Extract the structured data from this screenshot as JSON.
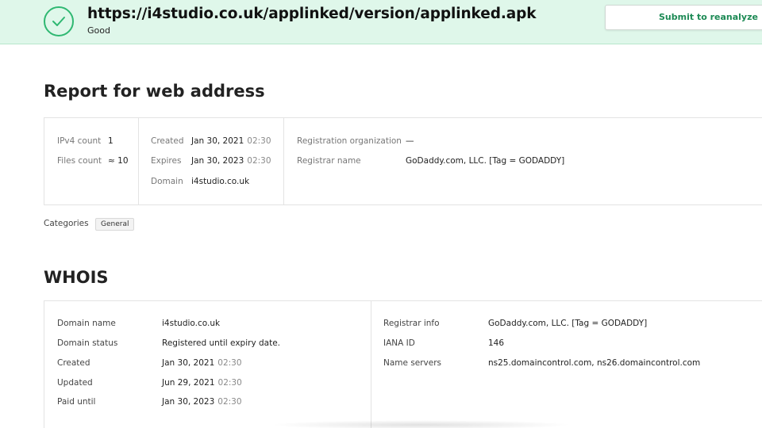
{
  "header": {
    "url": "https://i4studio.co.uk/applinked/version/applinked.apk",
    "verdict": "Good",
    "submit_label": "Submit to reanalyze",
    "status_icon": "check-circle-icon"
  },
  "report": {
    "title": "Report for web address",
    "col1": [
      {
        "label": "IPv4 count",
        "value": "1"
      },
      {
        "label": "Files count",
        "value": "≈ 10"
      }
    ],
    "col2": [
      {
        "label": "Created",
        "value": "Jan 30, 2021",
        "time": "02:30"
      },
      {
        "label": "Expires",
        "value": "Jan 30, 2023",
        "time": "02:30"
      },
      {
        "label": "Domain",
        "value": "i4studio.co.uk"
      }
    ],
    "col3": [
      {
        "label": "Registration organization",
        "value": "—"
      },
      {
        "label": "Registrar name",
        "value": "GoDaddy.com, LLC. [Tag = GODADDY]"
      }
    ],
    "categories_label": "Categories",
    "categories": [
      "General"
    ]
  },
  "whois": {
    "title": "WHOIS",
    "left": [
      {
        "label": "Domain name",
        "value": "i4studio.co.uk"
      },
      {
        "label": "Domain status",
        "value": "Registered until expiry date."
      },
      {
        "label": "Created",
        "value": "Jan 30, 2021",
        "time": "02:30"
      },
      {
        "label": "Updated",
        "value": "Jun 29, 2021",
        "time": "02:30"
      },
      {
        "label": "Paid until",
        "value": "Jan 30, 2023",
        "time": "02:30"
      }
    ],
    "right": [
      {
        "label": "Registrar info",
        "value": "GoDaddy.com, LLC. [Tag = GODADDY]"
      },
      {
        "label": "IANA ID",
        "value": "146"
      },
      {
        "label": "Name servers",
        "value": "ns25.domaincontrol.com, ns26.domaincontrol.com"
      }
    ]
  },
  "colors": {
    "accent": "#2fb872",
    "banner": "#dff7ea",
    "button_text": "#1d8a55"
  }
}
